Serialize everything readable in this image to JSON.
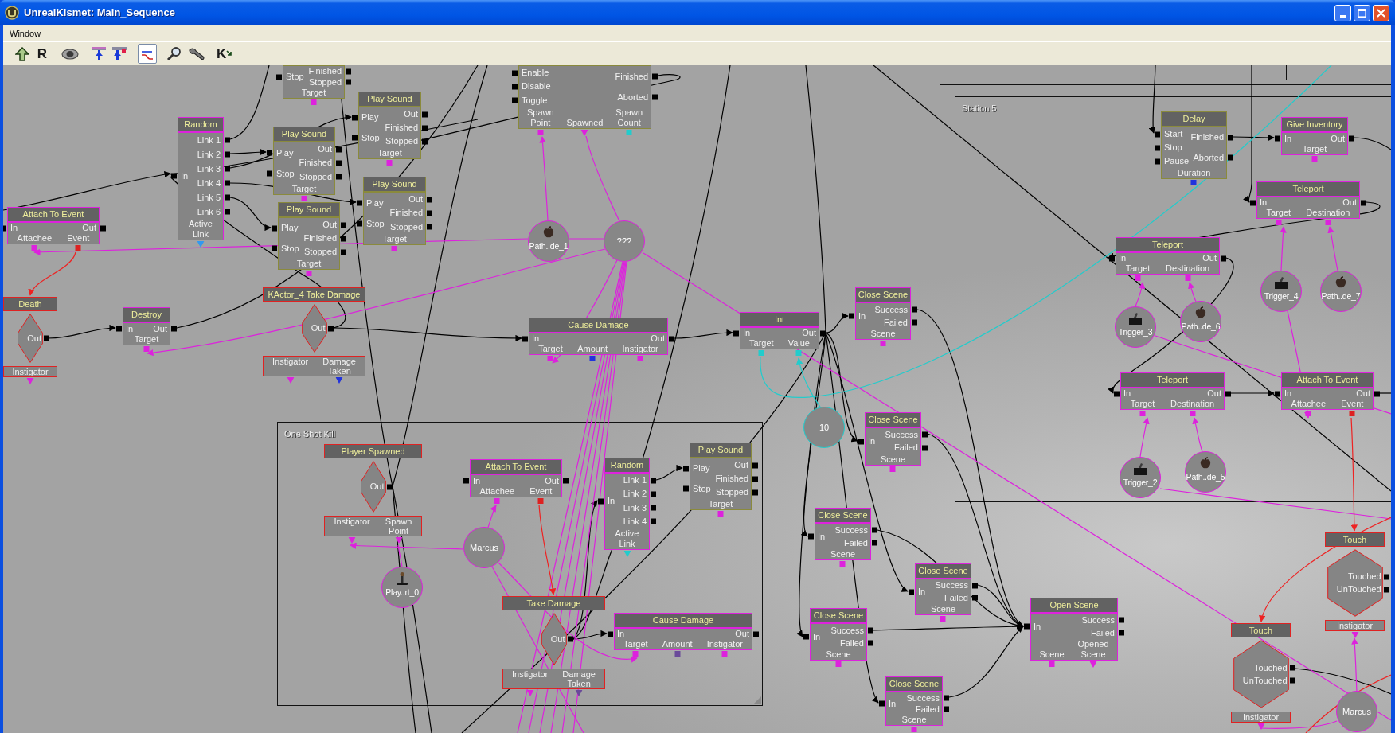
{
  "window": {
    "title": "UnrealKismet: Main_Sequence"
  },
  "menu": [
    {
      "label": "Window"
    }
  ],
  "toolbar": [
    {
      "selected": false
    },
    {
      "label": "R",
      "selected": false
    },
    {
      "selected": false
    },
    {
      "selected": false
    },
    {
      "selected": false
    },
    {
      "selected": true
    },
    {
      "selected": false
    },
    {
      "selected": false
    },
    {
      "label": "K",
      "selected": false
    }
  ],
  "comments": [
    {
      "label": "Station 5"
    },
    {
      "label": "One Shot Kill"
    }
  ],
  "nodes": [
    {
      "kind": "latent",
      "inputs": [
        "Stop"
      ],
      "outputs": [
        "Finished",
        "Stopped"
      ],
      "variables": [
        {
          "label": "Target",
          "color": "#dd22dd",
          "kind": "input"
        }
      ]
    },
    {
      "kind": "latent",
      "inputs": [
        "Enable",
        "Disable",
        "Toggle"
      ],
      "outputs": [
        "Finished",
        "Aborted"
      ],
      "variables": [
        {
          "label": "Spawn Point",
          "color": "#dd22dd",
          "kind": "input"
        },
        {
          "label": "Spawned",
          "color": "#dd22dd",
          "kind": "output"
        },
        {
          "label": "Spawn Count",
          "color": "#22cccc",
          "kind": "input"
        }
      ]
    },
    {
      "kind": "action",
      "title": "Random",
      "inputs": [
        "In"
      ],
      "outputs": [
        "Link 1",
        "Link 2",
        "Link 3",
        "Link 4",
        "Link 5",
        "Link 6"
      ],
      "variables": [
        {
          "label": "Active Link",
          "color": "#3399ee",
          "kind": "output"
        }
      ]
    },
    {
      "kind": "latent",
      "title": "Play Sound",
      "inputs": [
        "Play",
        "Stop"
      ],
      "outputs": [
        "Out",
        "Finished",
        "Stopped"
      ],
      "variables": [
        {
          "label": "Target",
          "color": "#dd22dd",
          "kind": "input"
        }
      ]
    },
    {
      "kind": "latent",
      "title": "Play Sound",
      "inputs": [
        "Play",
        "Stop"
      ],
      "outputs": [
        "Out",
        "Finished",
        "Stopped"
      ],
      "variables": [
        {
          "label": "Target",
          "color": "#dd22dd",
          "kind": "input"
        }
      ]
    },
    {
      "kind": "latent",
      "title": "Delay",
      "inputs": [
        "Start",
        "Stop",
        "Pause"
      ],
      "outputs": [
        "Finished",
        "Aborted"
      ],
      "variables": [
        {
          "label": "Duration",
          "color": "#2233dd",
          "kind": "input"
        }
      ]
    },
    {
      "kind": "action",
      "title": "Give Inventory",
      "inputs": [
        "In"
      ],
      "outputs": [
        "Out"
      ],
      "variables": [
        {
          "label": "Target",
          "color": "#dd22dd",
          "kind": "input"
        }
      ]
    },
    {
      "kind": "action",
      "title": "Attach To Event",
      "inputs": [
        "In"
      ],
      "outputs": [
        "Out"
      ],
      "variables": [
        {
          "label": "Attachee",
          "color": "#dd22dd",
          "kind": "input"
        },
        {
          "label": "Event",
          "color": "#dd2222",
          "kind": "input"
        }
      ]
    },
    {
      "kind": "latent",
      "title": "Play Sound",
      "inputs": [
        "Play",
        "Stop"
      ],
      "outputs": [
        "Out",
        "Finished",
        "Stopped"
      ],
      "variables": [
        {
          "label": "Target",
          "color": "#dd22dd",
          "kind": "input"
        }
      ]
    },
    {
      "kind": "latent",
      "title": "Play Sound",
      "inputs": [
        "Play",
        "Stop"
      ],
      "outputs": [
        "Out",
        "Finished",
        "Stopped"
      ],
      "variables": [
        {
          "label": "Target",
          "color": "#dd22dd",
          "kind": "input"
        }
      ]
    },
    {
      "kind": "pathnode",
      "label": "Path..de_1"
    },
    {
      "kind": "object",
      "label": "???"
    },
    {
      "kind": "action",
      "title": "Teleport",
      "inputs": [
        "In"
      ],
      "outputs": [
        "Out"
      ],
      "variables": [
        {
          "label": "Target",
          "color": "#dd22dd",
          "kind": "input"
        },
        {
          "label": "Destination",
          "color": "#dd22dd",
          "kind": "input"
        }
      ]
    },
    {
      "kind": "action",
      "title": "Teleport",
      "inputs": [
        "In"
      ],
      "outputs": [
        "Out"
      ],
      "variables": [
        {
          "label": "Target",
          "color": "#dd22dd",
          "kind": "input"
        },
        {
          "label": "Destination",
          "color": "#dd22dd",
          "kind": "input"
        }
      ]
    },
    {
      "kind": "trigger",
      "label": "Trigger_4"
    },
    {
      "kind": "pathnode",
      "label": "Path..de_7"
    },
    {
      "kind": "event",
      "title": "Death",
      "outputs": [
        "Out"
      ],
      "variables": [
        {
          "label": "Instigator",
          "color": "#dd22dd",
          "kind": "output"
        }
      ]
    },
    {
      "kind": "action",
      "title": "Destroy",
      "inputs": [
        "In"
      ],
      "outputs": [
        "Out"
      ],
      "variables": [
        {
          "label": "Target",
          "color": "#dd22dd",
          "kind": "input"
        }
      ]
    },
    {
      "kind": "event",
      "title": "KActor_4 Take Damage",
      "outputs": [
        "Out"
      ],
      "variables": [
        {
          "label": "Instigator",
          "color": "#dd22dd",
          "kind": "output"
        },
        {
          "label": "Damage Taken",
          "color": "#2233dd",
          "kind": "output"
        }
      ]
    },
    {
      "kind": "action",
      "title": "Cause Damage",
      "inputs": [
        "In"
      ],
      "outputs": [
        "Out"
      ],
      "variables": [
        {
          "label": "Target",
          "color": "#dd22dd",
          "kind": "input"
        },
        {
          "label": "Amount",
          "color": "#2233dd",
          "kind": "input"
        },
        {
          "label": "Instigator",
          "color": "#dd22dd",
          "kind": "input"
        }
      ]
    },
    {
      "kind": "action",
      "title": "Int",
      "inputs": [
        "In"
      ],
      "outputs": [
        "Out"
      ],
      "variables": [
        {
          "label": "Target",
          "color": "#22cccc",
          "kind": "input"
        },
        {
          "label": "Value",
          "color": "#22cccc",
          "kind": "input"
        }
      ]
    },
    {
      "kind": "action",
      "title": "Close Scene",
      "inputs": [
        "In"
      ],
      "outputs": [
        "Success",
        "Failed"
      ],
      "variables": [
        {
          "label": "Scene",
          "color": "#dd22dd",
          "kind": "input"
        }
      ]
    },
    {
      "kind": "trigger",
      "label": "Trigger_3"
    },
    {
      "kind": "pathnode",
      "label": "Path..de_6"
    },
    {
      "kind": "action",
      "title": "Teleport",
      "inputs": [
        "In"
      ],
      "outputs": [
        "Out"
      ],
      "variables": [
        {
          "label": "Target",
          "color": "#dd22dd",
          "kind": "input"
        },
        {
          "label": "Destination",
          "color": "#dd22dd",
          "kind": "input"
        }
      ]
    },
    {
      "kind": "action",
      "title": "Attach To Event",
      "inputs": [
        "In"
      ],
      "outputs": [
        "Out"
      ],
      "variables": [
        {
          "label": "Attachee",
          "color": "#dd22dd",
          "kind": "input"
        },
        {
          "label": "Event",
          "color": "#dd2222",
          "kind": "input"
        }
      ]
    },
    {
      "kind": "int",
      "label": "10"
    },
    {
      "kind": "action",
      "title": "Close Scene",
      "inputs": [
        "In"
      ],
      "outputs": [
        "Success",
        "Failed"
      ],
      "variables": [
        {
          "label": "Scene",
          "color": "#dd22dd",
          "kind": "input"
        }
      ]
    },
    {
      "kind": "event",
      "title": "Player Spawned",
      "outputs": [
        "Out"
      ],
      "variables": [
        {
          "label": "Instigator",
          "color": "#dd22dd",
          "kind": "output"
        },
        {
          "label": "Spawn Point",
          "color": "#dd22dd",
          "kind": "output"
        }
      ]
    },
    {
      "kind": "action",
      "title": "Attach To Event",
      "inputs": [
        "In"
      ],
      "outputs": [
        "Out"
      ],
      "variables": [
        {
          "label": "Attachee",
          "color": "#dd22dd",
          "kind": "input"
        },
        {
          "label": "Event",
          "color": "#dd2222",
          "kind": "input"
        }
      ]
    },
    {
      "kind": "action",
      "title": "Random",
      "inputs": [
        "In"
      ],
      "outputs": [
        "Link 1",
        "Link 2",
        "Link 3",
        "Link 4"
      ],
      "variables": [
        {
          "label": "Active Link",
          "color": "#22cccc",
          "kind": "output"
        }
      ]
    },
    {
      "kind": "latent",
      "title": "Play Sound",
      "inputs": [
        "Play",
        "Stop"
      ],
      "outputs": [
        "Out",
        "Finished",
        "Stopped"
      ],
      "variables": [
        {
          "label": "Target",
          "color": "#dd22dd",
          "kind": "input"
        }
      ]
    },
    {
      "kind": "trigger",
      "label": "Trigger_2"
    },
    {
      "kind": "pathnode",
      "label": "Path..de_5"
    },
    {
      "kind": "object",
      "label": "Marcus"
    },
    {
      "kind": "action",
      "title": "Close Scene",
      "inputs": [
        "In"
      ],
      "outputs": [
        "Success",
        "Failed"
      ],
      "variables": [
        {
          "label": "Scene",
          "color": "#dd22dd",
          "kind": "input"
        }
      ]
    },
    {
      "kind": "playerstart",
      "label": "Play..rt_0"
    },
    {
      "kind": "action",
      "title": "Close Scene",
      "inputs": [
        "In"
      ],
      "outputs": [
        "Success",
        "Failed"
      ],
      "variables": [
        {
          "label": "Scene",
          "color": "#dd22dd",
          "kind": "input"
        }
      ]
    },
    {
      "kind": "event",
      "title": "Touch",
      "outputs": [
        "Touched",
        "UnTouched"
      ],
      "variables": [
        {
          "label": "Instigator",
          "color": "#dd22dd",
          "kind": "output"
        }
      ]
    },
    {
      "kind": "event",
      "title": "Take Damage",
      "outputs": [
        "Out"
      ],
      "variables": [
        {
          "label": "Instigator",
          "color": "#dd22dd",
          "kind": "output"
        },
        {
          "label": "Damage Taken",
          "color": "#6a4a9a",
          "kind": "output"
        }
      ]
    },
    {
      "kind": "action",
      "title": "Cause Damage",
      "inputs": [
        "In"
      ],
      "outputs": [
        "Out"
      ],
      "variables": [
        {
          "label": "Target",
          "color": "#dd22dd",
          "kind": "input"
        },
        {
          "label": "Amount",
          "color": "#6a4a9a",
          "kind": "input"
        },
        {
          "label": "Instigator",
          "color": "#dd22dd",
          "kind": "input"
        }
      ]
    },
    {
      "kind": "action",
      "title": "Close Scene",
      "inputs": [
        "In"
      ],
      "outputs": [
        "Success",
        "Failed"
      ],
      "variables": [
        {
          "label": "Scene",
          "color": "#dd22dd",
          "kind": "input"
        }
      ]
    },
    {
      "kind": "action",
      "title": "Open Scene",
      "inputs": [
        "In"
      ],
      "outputs": [
        "Success",
        "Failed"
      ],
      "variables": [
        {
          "label": "Scene",
          "color": "#dd22dd",
          "kind": "input"
        },
        {
          "label": "Opened Scene",
          "color": "#dd22dd",
          "kind": "output"
        }
      ]
    },
    {
      "kind": "action",
      "title": "Close Scene",
      "inputs": [
        "In"
      ],
      "outputs": [
        "Success",
        "Failed"
      ],
      "variables": [
        {
          "label": "Scene",
          "color": "#dd22dd",
          "kind": "input"
        }
      ]
    },
    {
      "kind": "event",
      "title": "Touch",
      "outputs": [
        "Touched",
        "UnTouched"
      ],
      "variables": [
        {
          "label": "Instigator",
          "color": "#dd22dd",
          "kind": "output"
        }
      ]
    },
    {
      "kind": "object",
      "label": "Marcus"
    }
  ]
}
